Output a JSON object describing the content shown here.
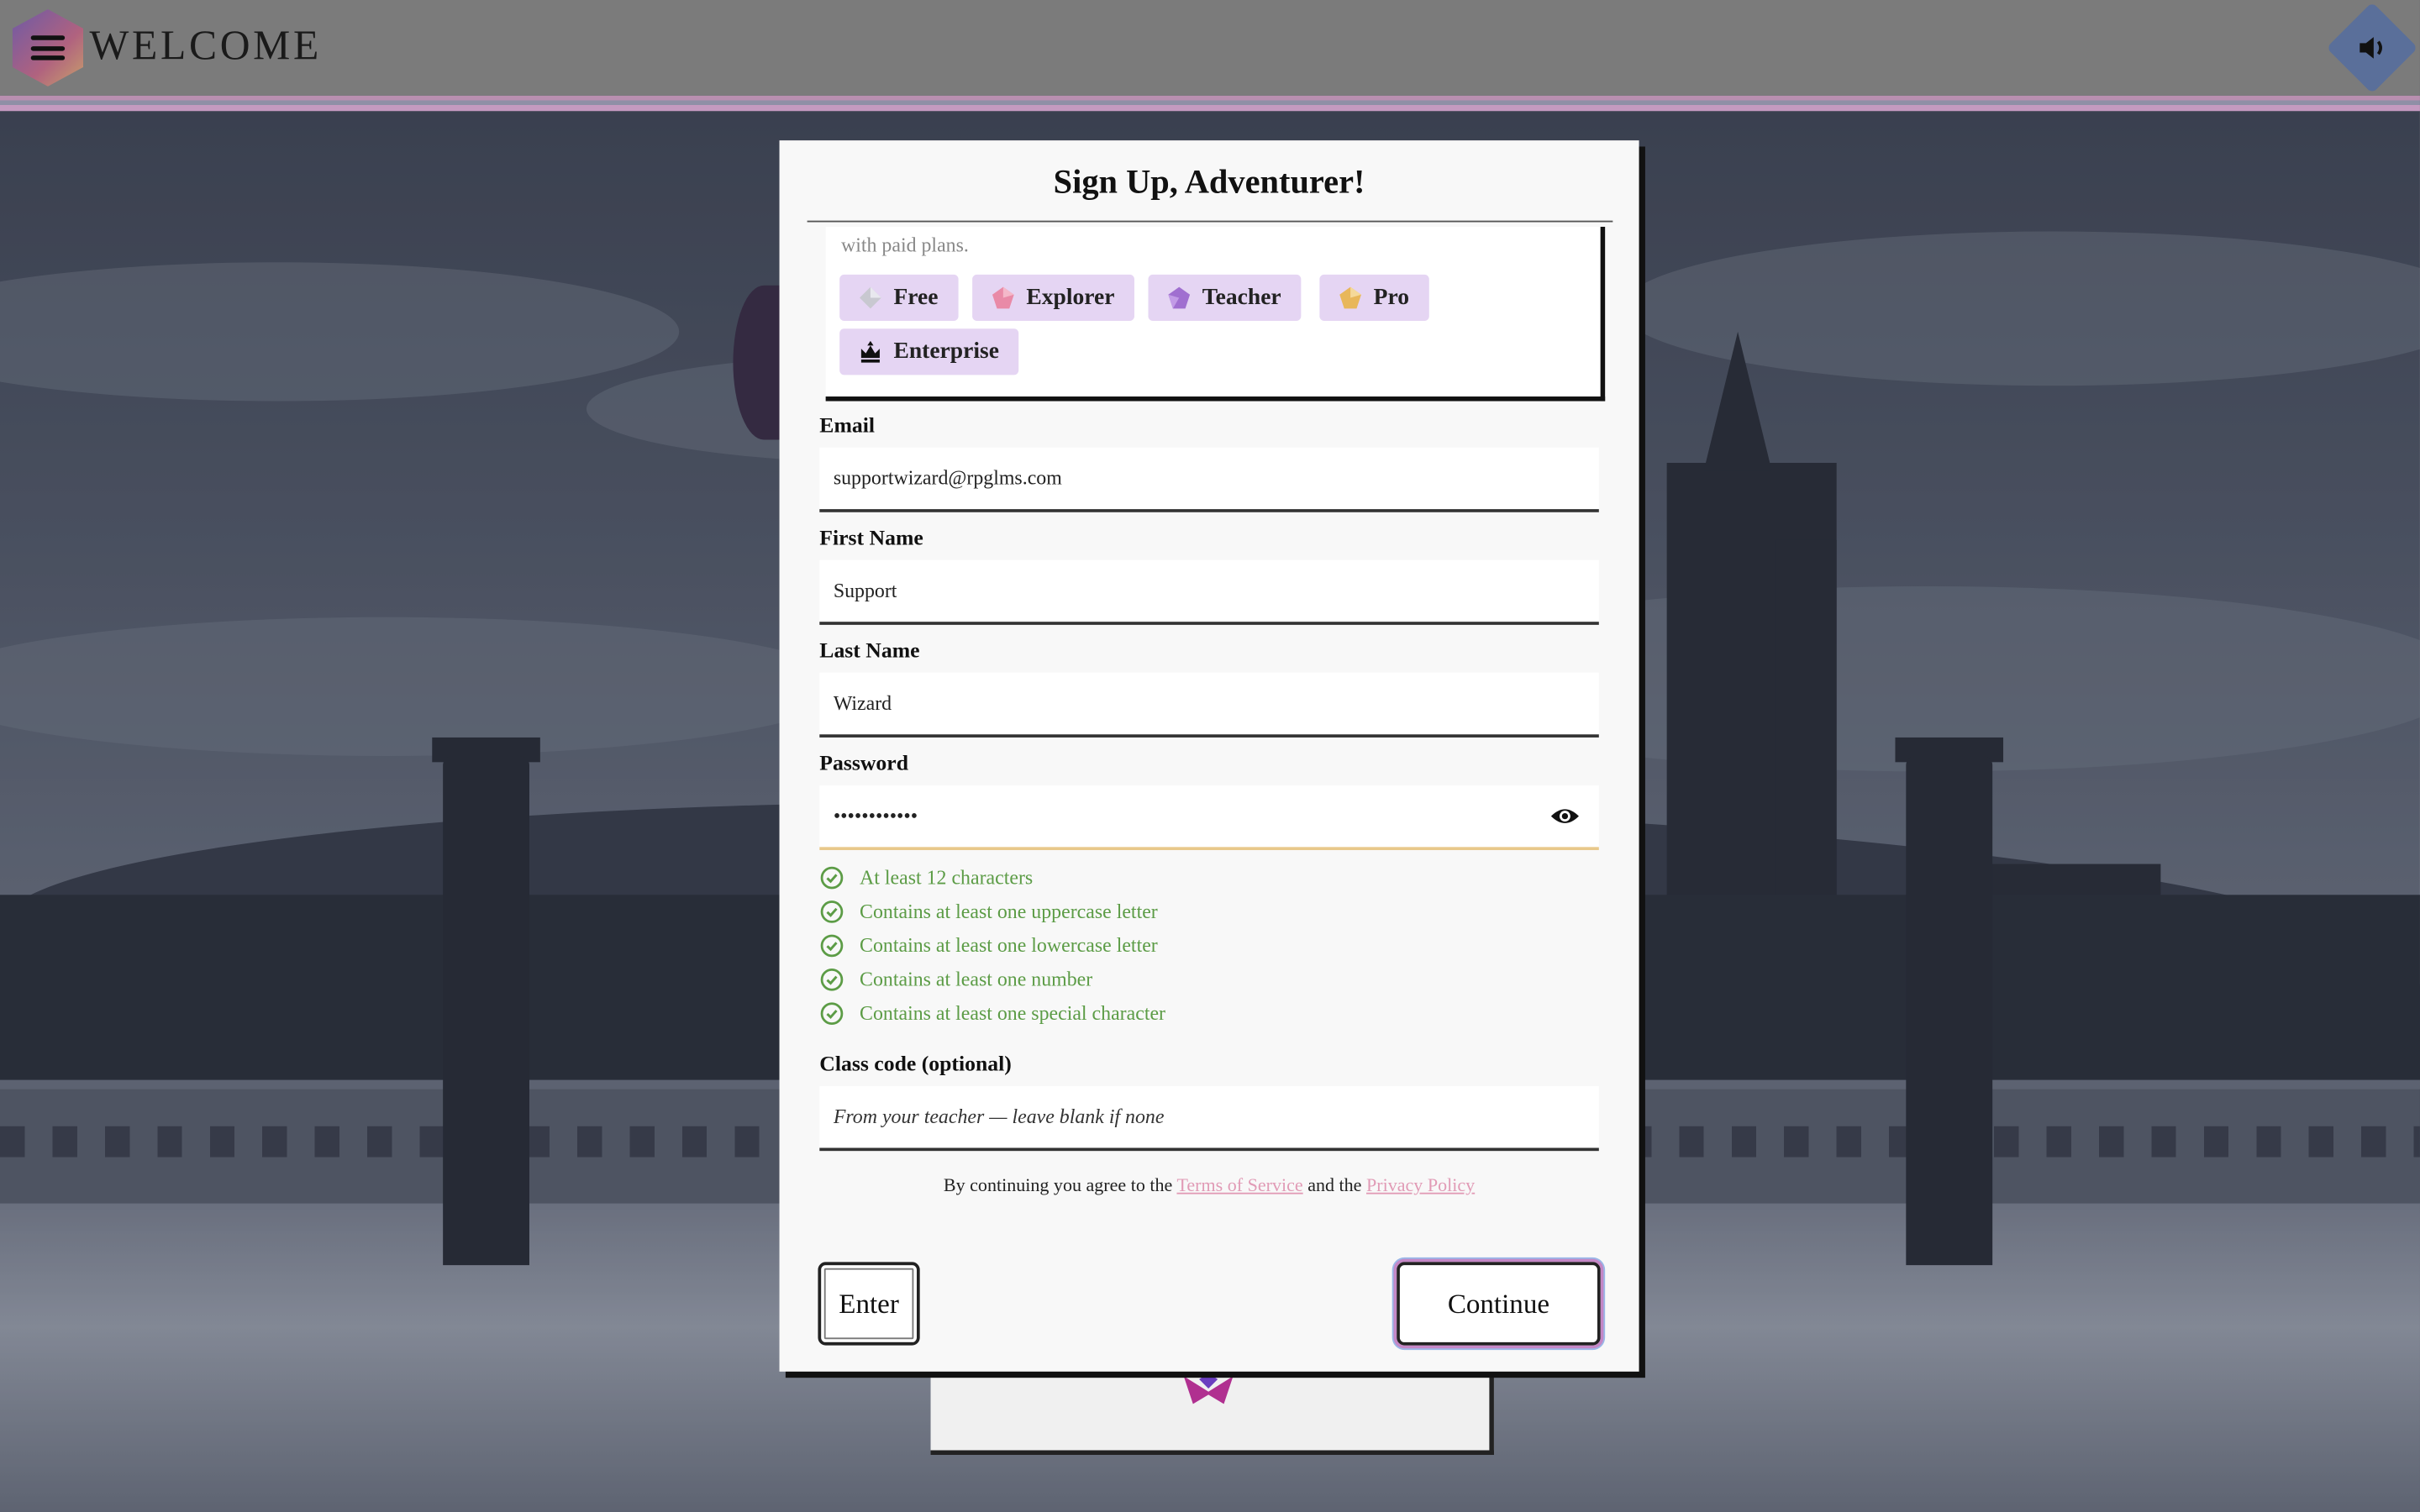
{
  "header": {
    "title": "WELCOME"
  },
  "modal": {
    "title": "Sign Up, Adventurer!",
    "plans_note": "with paid plans.",
    "plans": [
      {
        "label": "Free",
        "icon": "silver-gem-icon",
        "color": "#c8c8d0"
      },
      {
        "label": "Explorer",
        "icon": "pink-gem-icon",
        "color": "#e98aa7"
      },
      {
        "label": "Teacher",
        "icon": "purple-gem-icon",
        "color": "#a06fd0"
      },
      {
        "label": "Pro",
        "icon": "gold-gem-icon",
        "color": "#e8b75a"
      },
      {
        "label": "Enterprise",
        "icon": "crown-icon",
        "color": "#111111"
      }
    ],
    "email": {
      "label": "Email",
      "value": "supportwizard@rpglms.com"
    },
    "first_name": {
      "label": "First Name",
      "value": "Support"
    },
    "last_name": {
      "label": "Last Name",
      "value": "Wizard"
    },
    "password": {
      "label": "Password",
      "value": "••••••••••••"
    },
    "requirements": [
      "At least 12 characters",
      "Contains at least one uppercase letter",
      "Contains at least one lowercase letter",
      "Contains at least one number",
      "Contains at least one special character"
    ],
    "class_code": {
      "label": "Class code (optional)",
      "placeholder": "From your teacher — leave blank if none"
    },
    "agree": {
      "prefix": "By continuing you agree to the",
      "terms": "Terms of Service",
      "middle": "and the",
      "privacy": "Privacy Policy"
    },
    "enter_label": "Enter",
    "continue_label": "Continue"
  },
  "colors": {
    "accent_pink": "#e19bb6",
    "success_green": "#5c9c46",
    "chip_bg": "#e5d5f3"
  }
}
